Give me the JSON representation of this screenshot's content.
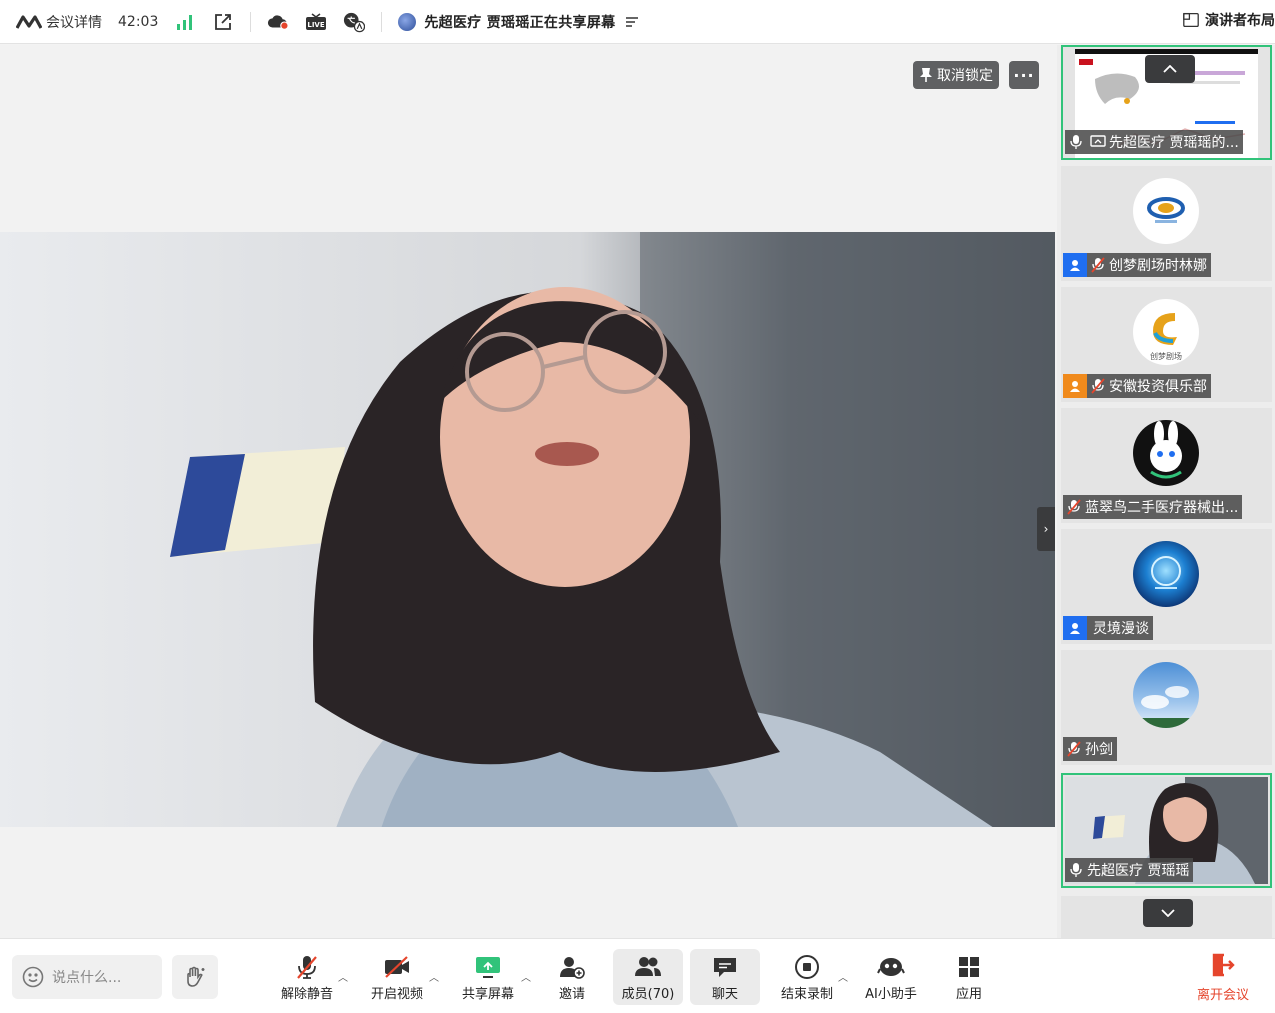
{
  "topbar": {
    "meeting_details": "会议详情",
    "timer": "42:03",
    "share_status": "先超医疗  贾瑶瑶正在共享屏幕",
    "layout_button": "演讲者布局",
    "live_badge": "LIVE"
  },
  "stage": {
    "unlock_button": "取消锁定",
    "more_button": "···"
  },
  "participants": [
    {
      "name": "先超医疗  贾瑶瑶的...",
      "role": "none",
      "muted": false,
      "avatar": "screen-share-thumbnail",
      "active": true
    },
    {
      "name": "创梦剧场时林娜",
      "role": "host",
      "muted": true,
      "avatar": "logo-avatar"
    },
    {
      "name": "安徽投资俱乐部",
      "role": "cohost",
      "muted": true,
      "avatar": "logo-avatar",
      "avatar_text": "创梦剧场"
    },
    {
      "name": "蓝翠鸟二手医疗器械出...",
      "role": "none",
      "muted": true,
      "avatar": "rabbit-avatar"
    },
    {
      "name": "灵境漫谈",
      "role": "host",
      "muted": false,
      "avatar": "globe-avatar"
    },
    {
      "name": "孙剑",
      "role": "none",
      "muted": true,
      "avatar": "sky-avatar"
    },
    {
      "name": "先超医疗  贾瑶瑶",
      "role": "none",
      "muted": false,
      "avatar": "video-thumbnail",
      "active": true
    }
  ],
  "bottombar": {
    "chat_placeholder": "说点什么...",
    "tools": [
      {
        "id": "unmute",
        "label": "解除静音"
      },
      {
        "id": "video",
        "label": "开启视频"
      },
      {
        "id": "share",
        "label": "共享屏幕"
      },
      {
        "id": "invite",
        "label": "邀请"
      },
      {
        "id": "members",
        "label": "成员(70)"
      },
      {
        "id": "chat",
        "label": "聊天"
      },
      {
        "id": "record",
        "label": "结束录制"
      },
      {
        "id": "ai",
        "label": "AI小助手"
      },
      {
        "id": "apps",
        "label": "应用"
      }
    ],
    "leave_label": "离开会议"
  },
  "colors": {
    "accent_green": "#31c37a",
    "leave_red": "#e5452c",
    "host_blue": "#1f6ef0",
    "cohost_orange": "#f08a1c"
  }
}
